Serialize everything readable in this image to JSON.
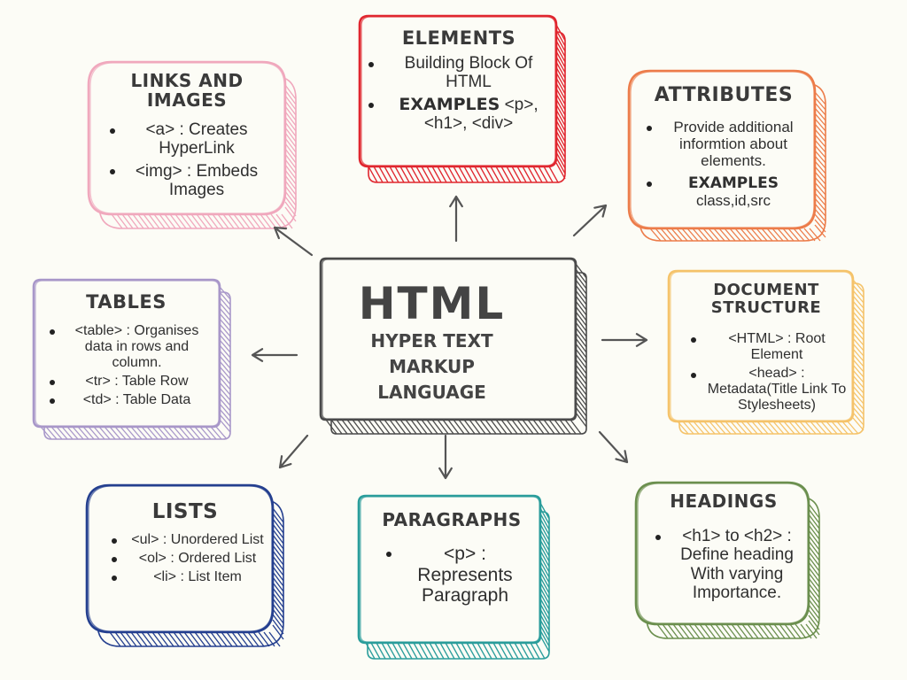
{
  "center": {
    "title": "HTML",
    "line1": "HYPER TEXT",
    "line2": "MARKUP",
    "line3": "LANGUAGE"
  },
  "elements": {
    "title": "ELEMENTS",
    "item1": "Building Block Of HTML",
    "item2_bold": "EXAMPLES",
    "item2_rest": " <p>, <h1>, <div>"
  },
  "links": {
    "title": "LINKS AND IMAGES",
    "item1": "<a> : Creates HyperLink",
    "item2": "<img> : Embeds Images"
  },
  "attributes": {
    "title": "ATTRIBUTES",
    "item1": "Provide additional informtion about elements.",
    "item2_bold": "EXAMPLES",
    "item2_rest": "class,id,src"
  },
  "tables": {
    "title": "TABLES",
    "item1": "<table> : Organises data in rows and column.",
    "item2": "<tr> : Table Row",
    "item3": "<td> : Table Data"
  },
  "document": {
    "title": "DOCUMENT STRUCTURE",
    "item1": "<HTML> : Root Element",
    "item2": "<head> : Metadata(Title Link To Stylesheets)"
  },
  "lists": {
    "title": "LISTS",
    "item1": "<ul> : Unordered List",
    "item2": "<ol> : Ordered List",
    "item3": "<li> : List Item"
  },
  "paragraphs": {
    "title": "PARAGRAPHS",
    "item1": "<p> : Represents Paragraph"
  },
  "headings": {
    "title": "HEADINGS",
    "item1": "<h1> to <h2> : Define heading With varying Importance."
  },
  "colors": {
    "elements": "#e0262f",
    "links": "#f0a8bd",
    "attributes": "#ec7c4a",
    "tables": "#a897c9",
    "document": "#f5c36a",
    "lists": "#243f8f",
    "paragraphs": "#2a9d9b",
    "headings": "#6b8f4e",
    "center": "#4a4a4a",
    "arrow": "#555555"
  }
}
